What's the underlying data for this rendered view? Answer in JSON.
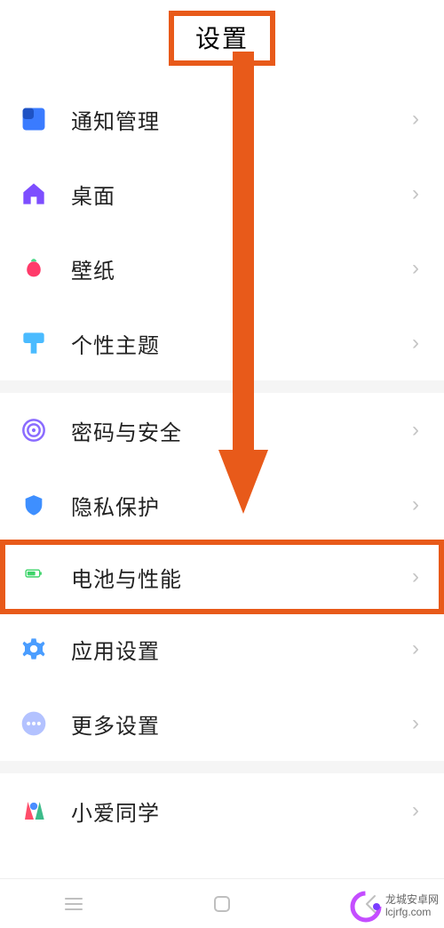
{
  "header": {
    "title": "设置"
  },
  "groups": [
    {
      "items": [
        {
          "id": "notification",
          "icon": "notification-icon",
          "label": "通知管理",
          "highlighted": false
        },
        {
          "id": "desktop",
          "icon": "home-icon",
          "label": "桌面",
          "highlighted": false
        },
        {
          "id": "wallpaper",
          "icon": "wallpaper-icon",
          "label": "壁纸",
          "highlighted": false
        },
        {
          "id": "theme",
          "icon": "theme-icon",
          "label": "个性主题",
          "highlighted": false
        }
      ]
    },
    {
      "items": [
        {
          "id": "password",
          "icon": "fingerprint-icon",
          "label": "密码与安全",
          "highlighted": false
        },
        {
          "id": "privacy",
          "icon": "shield-icon",
          "label": "隐私保护",
          "highlighted": false
        },
        {
          "id": "battery",
          "icon": "battery-icon",
          "label": "电池与性能",
          "highlighted": true
        },
        {
          "id": "appsettings",
          "icon": "gear-icon",
          "label": "应用设置",
          "highlighted": false
        },
        {
          "id": "more",
          "icon": "more-icon",
          "label": "更多设置",
          "highlighted": false
        }
      ]
    },
    {
      "items": [
        {
          "id": "xiaoai",
          "icon": "xiaoai-icon",
          "label": "小爱同学",
          "highlighted": false
        }
      ]
    }
  ],
  "watermark": {
    "line1": "龙城安卓网",
    "line2": "lcjrfg.com"
  },
  "annotations": {
    "arrow_from": "设置",
    "arrow_to": "电池与性能",
    "color": "#e85a1a"
  }
}
